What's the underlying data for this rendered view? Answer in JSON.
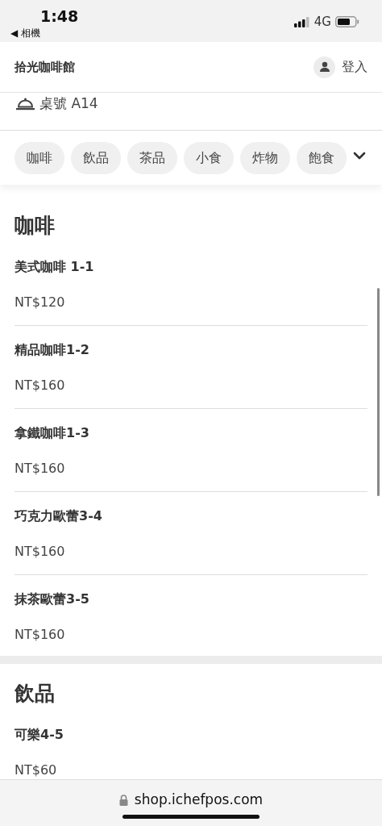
{
  "status_bar": {
    "time": "1:48",
    "back_label": "◀ 相機",
    "network": "4G"
  },
  "header": {
    "shop_name": "拾光咖啡館",
    "login_label": "登入"
  },
  "table_label": "桌號 A14",
  "category_tabs": [
    {
      "label": "咖啡",
      "selected": false
    },
    {
      "label": "飲品",
      "selected": false
    },
    {
      "label": "茶品",
      "selected": false
    },
    {
      "label": "小食",
      "selected": false
    },
    {
      "label": "炸物",
      "selected": false
    },
    {
      "label": "飽食",
      "selected": false
    }
  ],
  "sections": [
    {
      "title": "咖啡",
      "items": [
        {
          "name": "美式咖啡 1-1",
          "price": "NT$120"
        },
        {
          "name": "精品咖啡1-2",
          "price": "NT$160"
        },
        {
          "name": "拿鐵咖啡1-3",
          "price": "NT$160"
        },
        {
          "name": "巧克力歐蕾3-4",
          "price": "NT$160"
        },
        {
          "name": "抹茶歐蕾3-5",
          "price": "NT$160"
        }
      ]
    },
    {
      "title": "飲品",
      "items": [
        {
          "name": "可樂4-5",
          "price": "NT$60"
        }
      ]
    }
  ],
  "browser_bar": {
    "url": "shop.ichefpos.com"
  }
}
